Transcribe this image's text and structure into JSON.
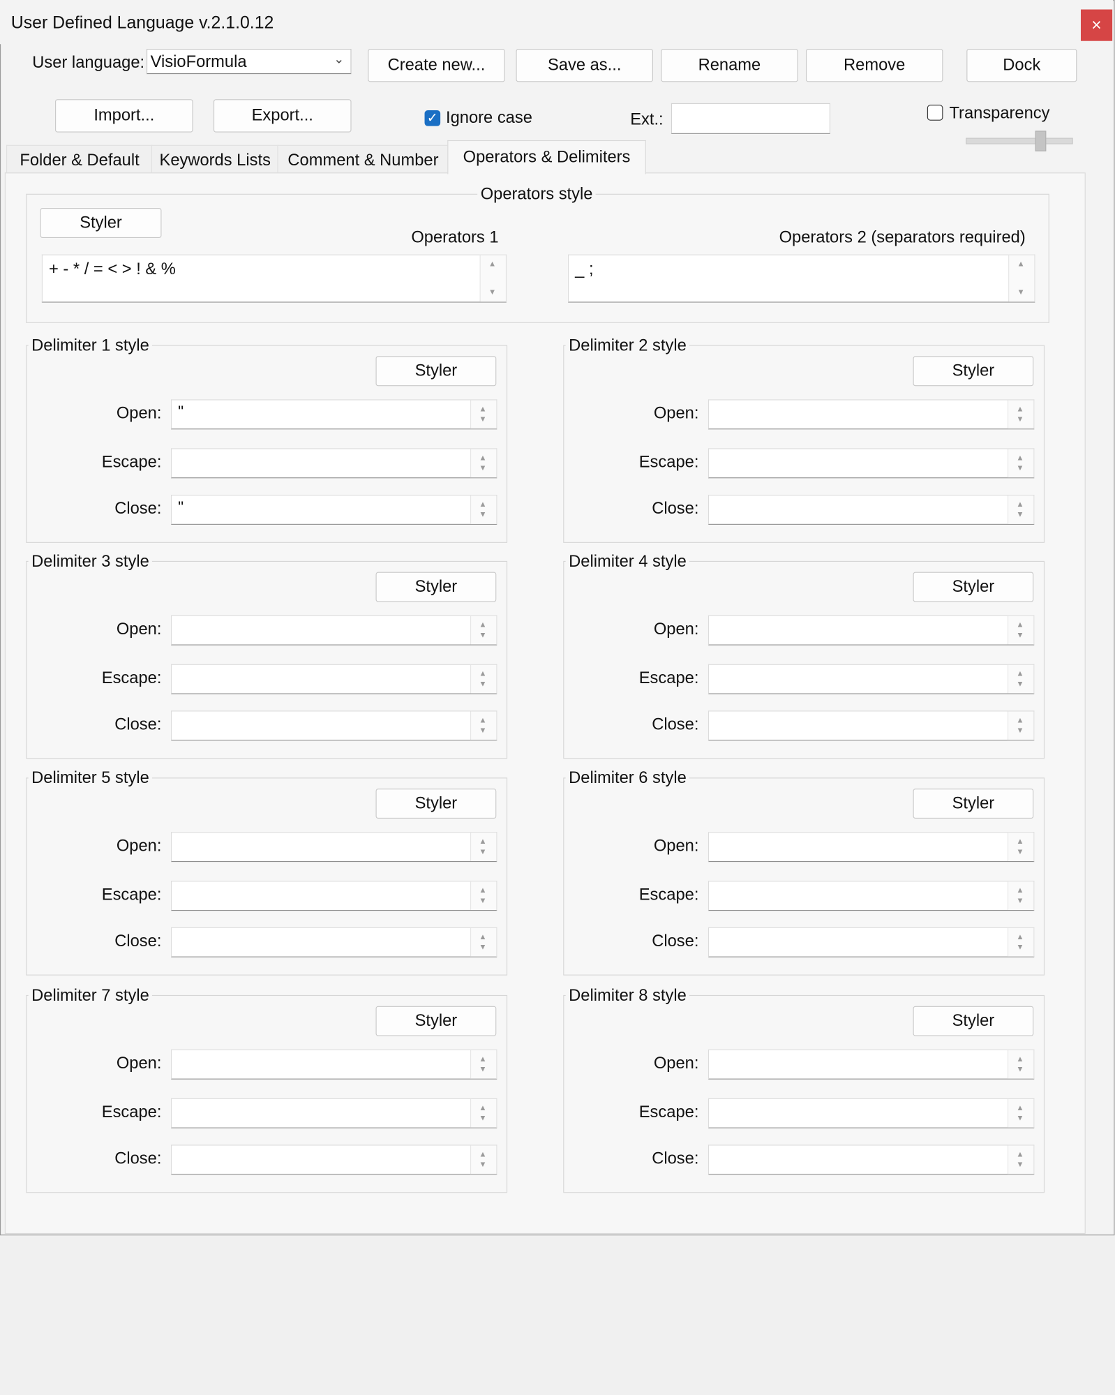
{
  "window": {
    "title": "User Defined Language v.2.1.0.12",
    "close_glyph": "×"
  },
  "toolbar": {
    "user_language_label": "User language:",
    "user_language_value": "VisioFormula",
    "create_new": "Create new...",
    "save_as": "Save as...",
    "rename": "Rename",
    "remove": "Remove",
    "dock": "Dock",
    "import": "Import...",
    "export": "Export...",
    "ignore_case_label": "Ignore case",
    "ignore_case_checked": true,
    "ext_label": "Ext.:",
    "ext_value": "",
    "transparency_label": "Transparency",
    "transparency_checked": false
  },
  "tabs": [
    {
      "label": "Folder & Default",
      "active": false
    },
    {
      "label": "Keywords Lists",
      "active": false
    },
    {
      "label": "Comment & Number",
      "active": false
    },
    {
      "label": "Operators & Delimiters",
      "active": true
    }
  ],
  "operators": {
    "group_title": "Operators style",
    "styler_label": "Styler",
    "ops1_label": "Operators 1",
    "ops1_value": "+ - * / = < > ! & %",
    "ops2_label": "Operators 2 (separators required)",
    "ops2_value": "_ ;"
  },
  "delimiters": [
    {
      "title": "Delimiter 1 style",
      "styler": "Styler",
      "open_label": "Open:",
      "escape_label": "Escape:",
      "close_label": "Close:",
      "open": "\"",
      "escape": "",
      "close": "\""
    },
    {
      "title": "Delimiter 2 style",
      "styler": "Styler",
      "open_label": "Open:",
      "escape_label": "Escape:",
      "close_label": "Close:",
      "open": "",
      "escape": "",
      "close": ""
    },
    {
      "title": "Delimiter 3 style",
      "styler": "Styler",
      "open_label": "Open:",
      "escape_label": "Escape:",
      "close_label": "Close:",
      "open": "",
      "escape": "",
      "close": ""
    },
    {
      "title": "Delimiter 4 style",
      "styler": "Styler",
      "open_label": "Open:",
      "escape_label": "Escape:",
      "close_label": "Close:",
      "open": "",
      "escape": "",
      "close": ""
    },
    {
      "title": "Delimiter 5 style",
      "styler": "Styler",
      "open_label": "Open:",
      "escape_label": "Escape:",
      "close_label": "Close:",
      "open": "",
      "escape": "",
      "close": ""
    },
    {
      "title": "Delimiter 6 style",
      "styler": "Styler",
      "open_label": "Open:",
      "escape_label": "Escape:",
      "close_label": "Close:",
      "open": "",
      "escape": "",
      "close": ""
    },
    {
      "title": "Delimiter 7 style",
      "styler": "Styler",
      "open_label": "Open:",
      "escape_label": "Escape:",
      "close_label": "Close:",
      "open": "",
      "escape": "",
      "close": ""
    },
    {
      "title": "Delimiter 8 style",
      "styler": "Styler",
      "open_label": "Open:",
      "escape_label": "Escape:",
      "close_label": "Close:",
      "open": "",
      "escape": "",
      "close": ""
    }
  ],
  "colors": {
    "close_button": "#d64545",
    "checkbox_accent": "#1a6fc4",
    "background": "#f3f3f3"
  }
}
